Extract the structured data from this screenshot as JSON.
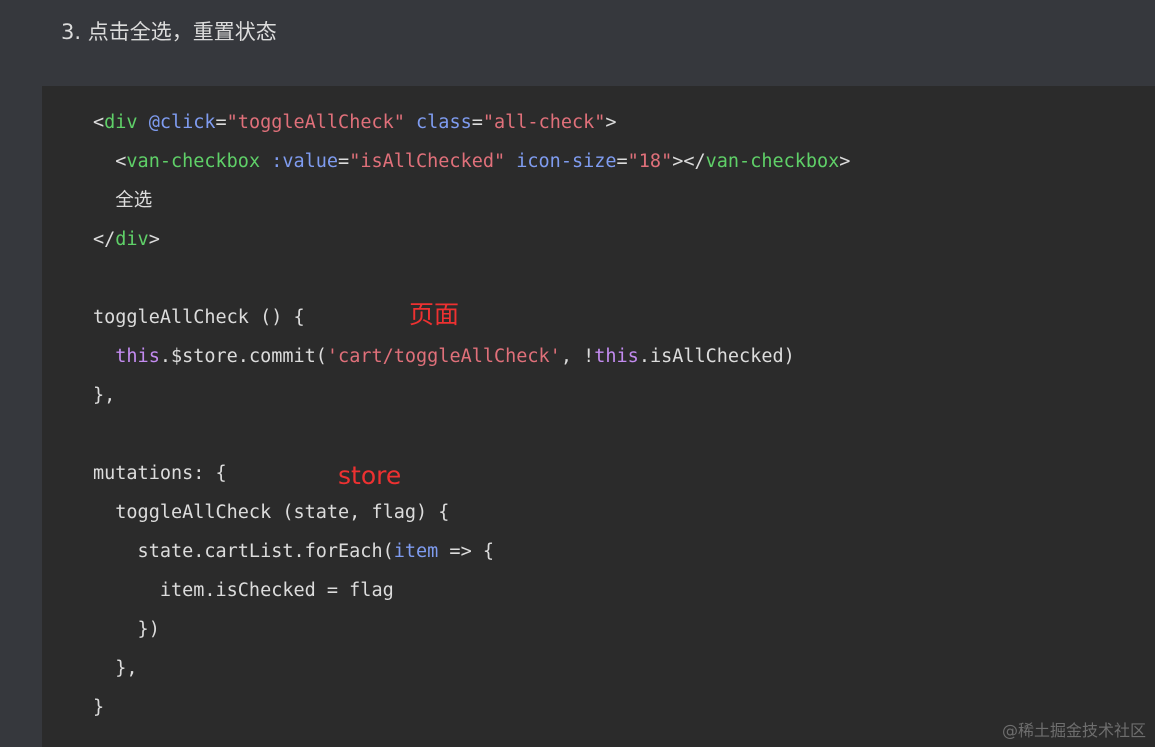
{
  "heading": "3. 点击全选，重置状态",
  "code": {
    "l1": {
      "open": "<",
      "tag": "div",
      "attr1": "@click",
      "eq1": "=",
      "val1": "\"toggleAllCheck\"",
      "attr2": "class",
      "eq2": "=",
      "val2": "\"all-check\"",
      "close": ">"
    },
    "l2": {
      "indent": "  ",
      "open": "<",
      "tag": "van-checkbox",
      "attr1": ":value",
      "eq1": "=",
      "val1": "\"isAllChecked\"",
      "attr2": "icon-size",
      "eq2": "=",
      "val2": "\"18\"",
      "mid": "></",
      "tag2": "van-checkbox",
      "close": ">"
    },
    "l3": {
      "indent": "  ",
      "text": "全选"
    },
    "l4": {
      "open": "</",
      "tag": "div",
      "close": ">"
    },
    "l5": {
      "text": "toggleAllCheck () {"
    },
    "l6": {
      "indent": "  ",
      "kw1": "this",
      "mid1": ".$store.commit(",
      "str": "'cart/toggleAllCheck'",
      "mid2": ", !",
      "kw2": "this",
      "end": ".isAllChecked)"
    },
    "l7": {
      "text": "},"
    },
    "l8": {
      "text": "mutations: {"
    },
    "l9": {
      "text": "  toggleAllCheck (state, flag) {"
    },
    "l10": {
      "pre": "    state.cartList.forEach(",
      "param": "item",
      "post": " => {"
    },
    "l11": {
      "text": "      item.isChecked = flag"
    },
    "l12": {
      "text": "    })"
    },
    "l13": {
      "text": "  },"
    },
    "l14": {
      "text": "}"
    }
  },
  "annotations": {
    "page": "页面",
    "store": "store"
  },
  "watermark": "@稀土掘金技术社区",
  "colors": {
    "page_bg": "#36383d",
    "code_bg": "#2b2b2b",
    "tag": "#5fd068",
    "attr": "#7f9cf0",
    "string": "#e0707a",
    "keyword": "#c38bf0",
    "annotation": "#ee3131"
  }
}
